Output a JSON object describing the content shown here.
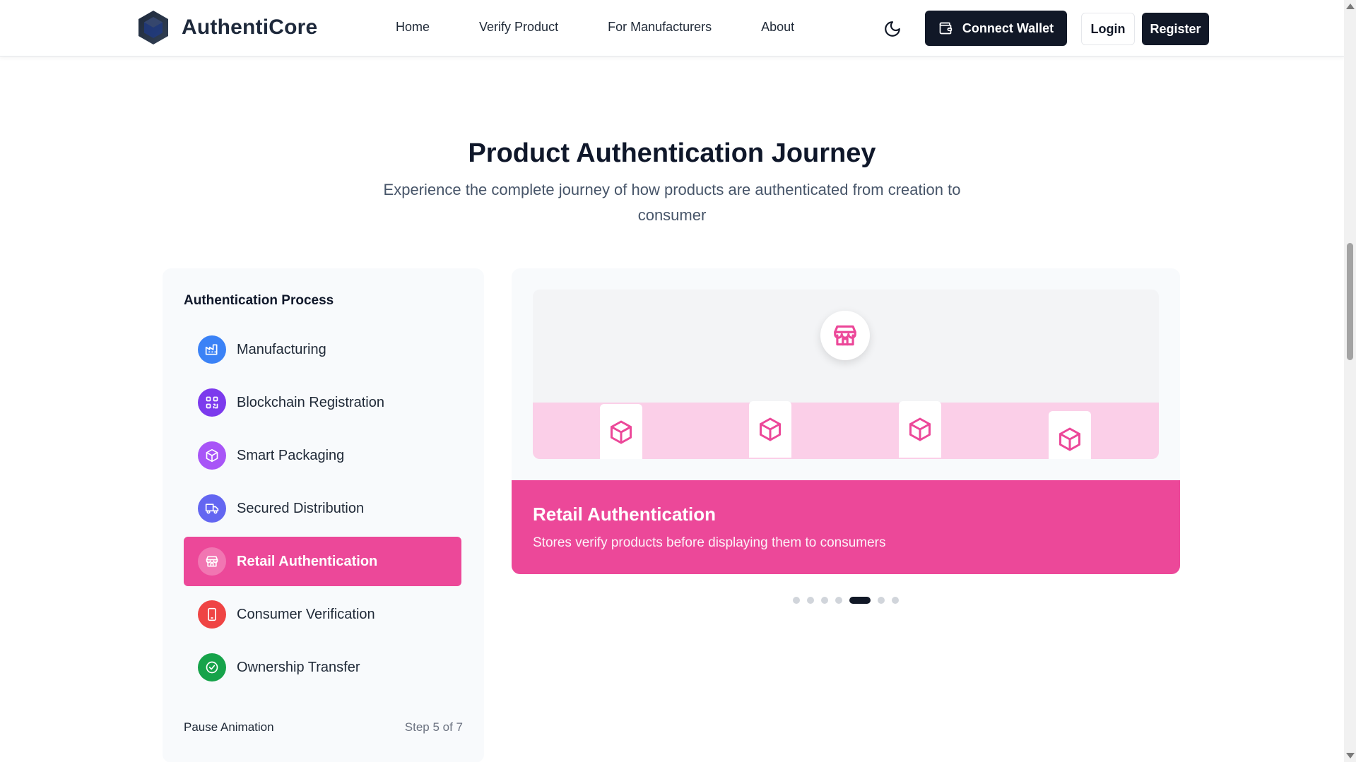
{
  "header": {
    "brand": "AuthentiCore",
    "nav": [
      "Home",
      "Verify Product",
      "For Manufacturers",
      "About"
    ],
    "connect_wallet": "Connect Wallet",
    "login": "Login",
    "register": "Register"
  },
  "hero": {
    "title": "Product Authentication Journey",
    "subtitle": "Experience the complete journey of how products are authenticated from creation to consumer"
  },
  "process": {
    "title": "Authentication Process",
    "steps": [
      {
        "label": "Manufacturing",
        "icon": "factory-icon",
        "color": "#3b82f6"
      },
      {
        "label": "Blockchain Registration",
        "icon": "qr-code-icon",
        "color": "#7c3aed"
      },
      {
        "label": "Smart Packaging",
        "icon": "package-icon",
        "color": "#a855f7"
      },
      {
        "label": "Secured Distribution",
        "icon": "truck-icon",
        "color": "#6366f1"
      },
      {
        "label": "Retail Authentication",
        "icon": "store-icon",
        "color": "#ec4899"
      },
      {
        "label": "Consumer Verification",
        "icon": "smartphone-icon",
        "color": "#ef4444"
      },
      {
        "label": "Ownership Transfer",
        "icon": "check-circle-icon",
        "color": "#16a34a"
      }
    ],
    "active_step": 5,
    "pause": "Pause Animation",
    "step_info": "Step 5 of 7"
  },
  "detail": {
    "title": "Retail Authentication",
    "description": "Stores verify products before displaying them to consumers",
    "accent": "#ec4899"
  },
  "carousel": {
    "total": 7,
    "active": 5
  }
}
